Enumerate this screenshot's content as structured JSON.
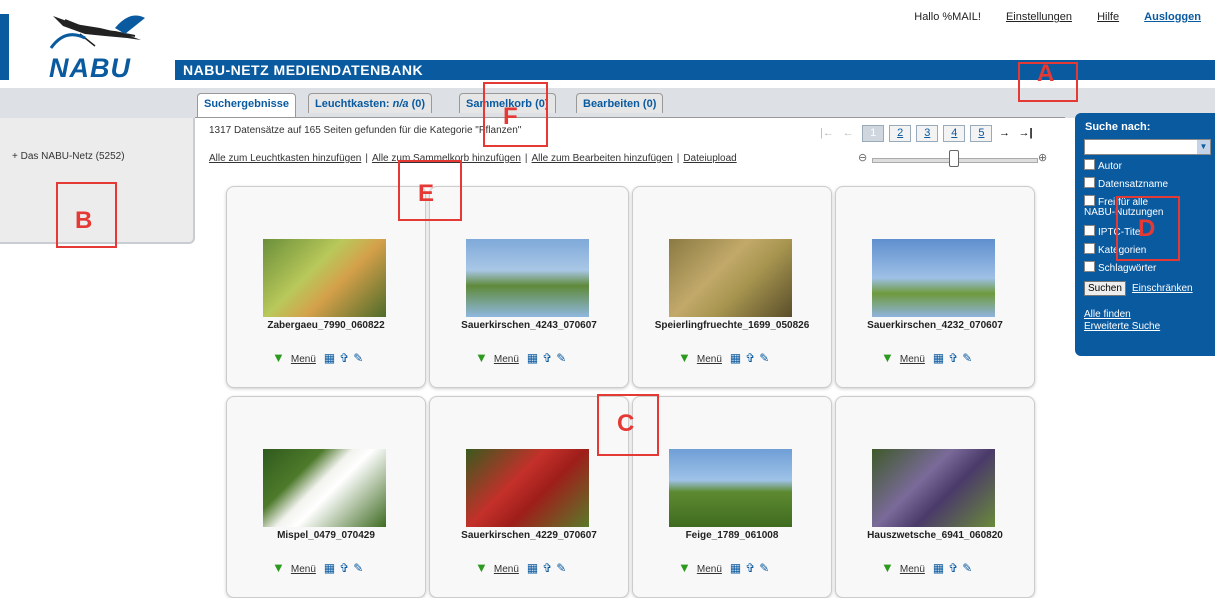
{
  "header": {
    "logo": "NABU",
    "app_title": "NABU-NETZ MEDIENDATENBANK",
    "greeting": "Hallo %MAIL!",
    "settings": "Einstellungen",
    "help": "Hilfe",
    "logout": "Ausloggen",
    "brand_color": "#0a5aa0"
  },
  "sidebar": {
    "tree_item": "+ Das NABU-Netz (5252)"
  },
  "tabs": [
    {
      "prefix": "Suchergebnisse",
      "suffix": ""
    },
    {
      "prefix": "Leuchtkasten: ",
      "italic": "n/a",
      "suffix": " (0)"
    },
    {
      "prefix": "Sammelkorb (0)",
      "suffix": ""
    },
    {
      "prefix": "Bearbeiten (0)",
      "suffix": ""
    }
  ],
  "results": {
    "count_text": "1317 Datensätze auf 165 Seiten gefunden für die Kategorie \"Pflanzen\"",
    "actions": [
      "Alle zum Leuchtkasten hinzufügen",
      "Alle zum Sammelkorb hinzufügen",
      "Alle zum Bearbeiten hinzufügen",
      "Dateiupload"
    ],
    "separator": "|"
  },
  "pager": {
    "first": "|←",
    "prev": "←",
    "pages": [
      "1",
      "2",
      "3",
      "4",
      "5"
    ],
    "current_page": "1",
    "next": "→",
    "last": "→|"
  },
  "zoom": {
    "out": "⊖",
    "in": "⊕",
    "level": 0.48
  },
  "cards": [
    {
      "caption": "Zabergaeu_7990_060822"
    },
    {
      "caption": "Sauerkirschen_4243_070607"
    },
    {
      "caption": "Speierlingfruechte_1699_050826"
    },
    {
      "caption": "Sauerkirschen_4232_070607"
    },
    {
      "caption": "Mispel_0479_070429"
    },
    {
      "caption": "Sauerkirschen_4229_070607"
    },
    {
      "caption": "Feige_1789_061008"
    },
    {
      "caption": "Hauszwetsche_6941_060820"
    }
  ],
  "card_tools": {
    "menu_label": "Menü"
  },
  "search": {
    "title": "Suche nach:",
    "options": [
      "Autor",
      "Datensatzname",
      "Frei für alle",
      "NABU-Nutzungen",
      "IPTC-Titel",
      "Kategorien",
      "Schlagwörter"
    ],
    "search_button": "Suchen",
    "restrict": "Einschränken",
    "find_all": "Alle finden",
    "advanced": "Erweiterte Suche"
  },
  "annotations": [
    "A",
    "B",
    "C",
    "D",
    "E",
    "F"
  ]
}
